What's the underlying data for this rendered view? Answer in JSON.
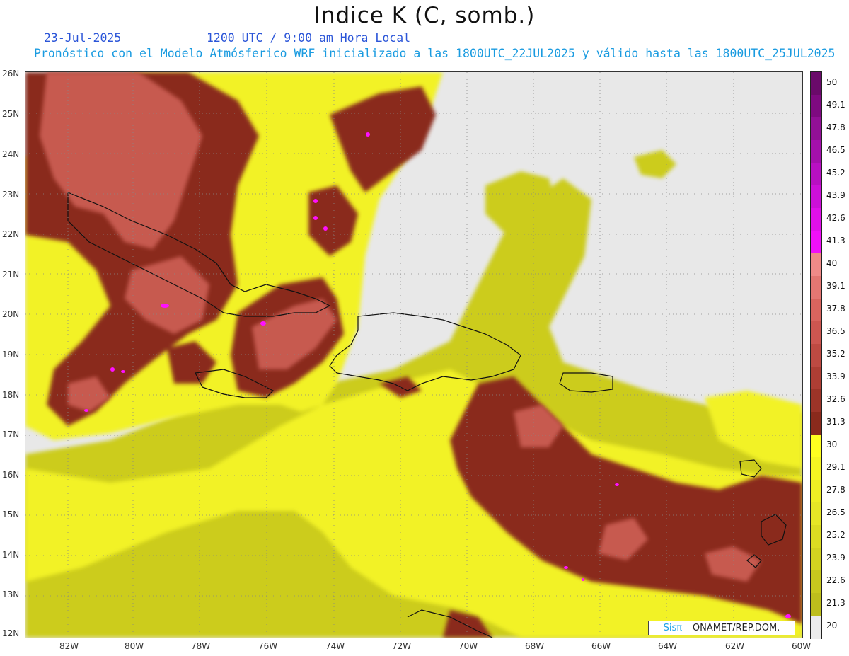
{
  "header": {
    "title": "Indice K (C, somb.)",
    "date": "23-Jul-2025",
    "time": "1200 UTC / 9:00 am Hora Local",
    "model_line": "Pronóstico con el Modelo Atmósferico WRF inicializado a las 1800UTC_22JUL2025 y válido hasta las  1800UTC_25JUL2025"
  },
  "map": {
    "lat_labels": [
      "26N",
      "25N",
      "24N",
      "23N",
      "22N",
      "21N",
      "20N",
      "19N",
      "18N",
      "17N",
      "16N",
      "15N",
      "14N",
      "13N",
      "12N"
    ],
    "lon_labels": [
      "82W",
      "80W",
      "78W",
      "76W",
      "74W",
      "72W",
      "70W",
      "68W",
      "66W",
      "64W",
      "62W",
      "60W"
    ]
  },
  "colorbar": {
    "labels": [
      "50",
      "49.1",
      "47.8",
      "46.5",
      "45.2",
      "43.9",
      "42.6",
      "41.3",
      "40",
      "39.1",
      "37.8",
      "36.5",
      "35.2",
      "33.9",
      "32.6",
      "31.3",
      "30",
      "29.1",
      "27.8",
      "26.5",
      "25.2",
      "23.9",
      "22.6",
      "21.3",
      "20"
    ],
    "colors": [
      "#6a0a6a",
      "#7e0a80",
      "#921096",
      "#a410ac",
      "#b810c2",
      "#cc10d8",
      "#e010ea",
      "#f010f8",
      "#f08a88",
      "#e47672",
      "#d8645e",
      "#cc5650",
      "#be4a42",
      "#ae3e34",
      "#9c3428",
      "#8a2a1c",
      "#ffff20",
      "#f6f622",
      "#eeee24",
      "#e6e626",
      "#dcdc22",
      "#d2d220",
      "#c8c81e",
      "#bebe1c",
      "#ebebeb"
    ],
    "palette": {
      "land_fill": "#e8e8e8",
      "yellow": "#f2f226",
      "olive": "#cccc1e",
      "brown": "#8a2a1c",
      "salmon": "#c75a50",
      "magenta": "#ff10ff"
    }
  },
  "credit": {
    "brand": "Sisπ",
    "rest": "– ONAMET/REP.DOM."
  }
}
